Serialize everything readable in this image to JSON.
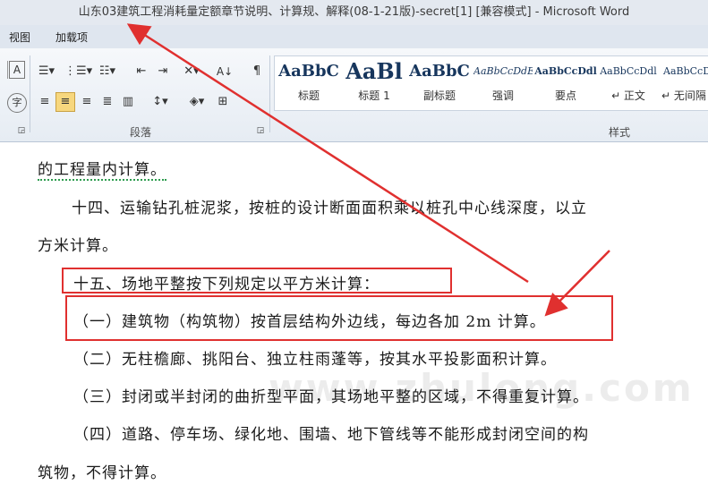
{
  "window": {
    "title": "山东03建筑工程消耗量定额章节说明、计算规、解释(08-1-21版)-secret[1] [兼容模式]  -  Microsoft Word"
  },
  "menu": {
    "items": [
      "视图",
      "加载项"
    ]
  },
  "ribbon": {
    "paragraph_group_label": "段落",
    "styles_group_label": "样式",
    "styles": [
      {
        "sample": "AaBbC",
        "name": "标题"
      },
      {
        "sample": "AaBl",
        "name": "标题 1"
      },
      {
        "sample": "AaBbC",
        "name": "副标题"
      },
      {
        "sample": "AaBbCcDdE",
        "name": "强调"
      },
      {
        "sample": "AaBbCcDdl",
        "name": "要点"
      },
      {
        "sample": "AaBbCcDdl",
        "name": "↵ 正文"
      },
      {
        "sample": "AaBbCcDd",
        "name": "↵ 无间隔"
      }
    ]
  },
  "document": {
    "lines": [
      "的工程量内计算。",
      "十四、运输钻孔桩泥浆，按桩的设计断面面积乘以桩孔中心线深度，以立",
      "方米计算。",
      "十五、场地平整按下列规定以平方米计算：",
      "（一）建筑物（构筑物）按首层结构外边线，每边各加 2m 计算。",
      "（二）无柱檐廊、挑阳台、独立柱雨蓬等，按其水平投影面积计算。",
      "（三）封闭或半封闭的曲折型平面，其场地平整的区域，不得重复计算。",
      "（四）道路、停车场、绿化地、围墙、地下管线等不能形成封闭空间的构",
      "筑物，不得计算。"
    ],
    "watermark": "www.zhulong.com"
  },
  "colors": {
    "annotation_red": "#e0302f",
    "title_bar": "#e4e9f0",
    "ribbon": "#e6ecf3"
  }
}
